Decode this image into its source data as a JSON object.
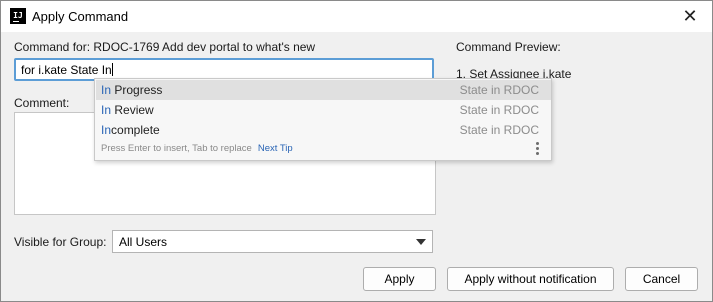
{
  "window": {
    "title": "Apply Command",
    "close_glyph": "✕",
    "app_icon_text": "IJ"
  },
  "form": {
    "command_label": "Command for: RDOC-1769 Add dev portal to what's new",
    "command_value": "for i.kate State In",
    "comment_label": "Comment:",
    "visible_group_label": "Visible for Group:",
    "visible_group_value": "All Users"
  },
  "preview": {
    "label": "Command Preview:",
    "line1": "1. Set Assignee i.kate"
  },
  "autocomplete": {
    "items": [
      {
        "match": "In",
        "rest": " Progress",
        "state": "State in RDOC",
        "selected": true
      },
      {
        "match": "In",
        "rest": " Review",
        "state": "State in RDOC",
        "selected": false
      },
      {
        "match": "In",
        "rest": "complete",
        "state": "State in RDOC",
        "selected": false
      }
    ],
    "hint": "Press Enter to insert, Tab to replace",
    "next_tip": "Next Tip"
  },
  "buttons": {
    "apply": "Apply",
    "apply_silent": "Apply without notification",
    "cancel": "Cancel"
  },
  "colors": {
    "accent": "#2a65b5",
    "focus_border": "#5c9dd6",
    "selected_row": "#e0e0e0",
    "error_mark": "#e0454f"
  },
  "icons": {
    "close": "close-icon",
    "app": "intellij-icon",
    "more": "more-vertical-icon",
    "dropdown": "chevron-down-icon"
  }
}
